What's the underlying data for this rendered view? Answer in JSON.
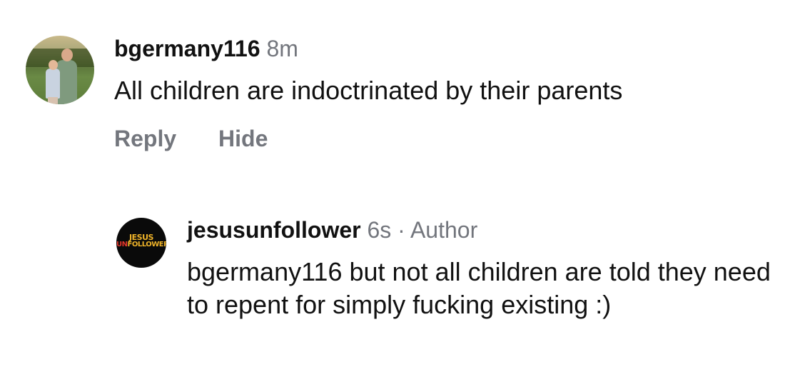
{
  "comments": [
    {
      "username": "bgermany116",
      "time": "8m",
      "text": "All children are indoctrinated by their parents",
      "actions": {
        "reply_label": "Reply",
        "hide_label": "Hide"
      },
      "avatar_icon": "profile-photo"
    },
    {
      "username": "jesusunfollower",
      "time": "6s",
      "separator": "·",
      "author_badge": "Author",
      "text": "bgermany116 but not all children are told they need to repent for simply fucking existing :)",
      "avatar": {
        "logo_line1": "JESUS",
        "logo_line2_prefix": "UN",
        "logo_line2_suffix": "FOLLOWER"
      }
    }
  ],
  "colors": {
    "meta_gray": "#73767d",
    "logo_yellow": "#f0b429",
    "logo_red": "#e2352a"
  }
}
